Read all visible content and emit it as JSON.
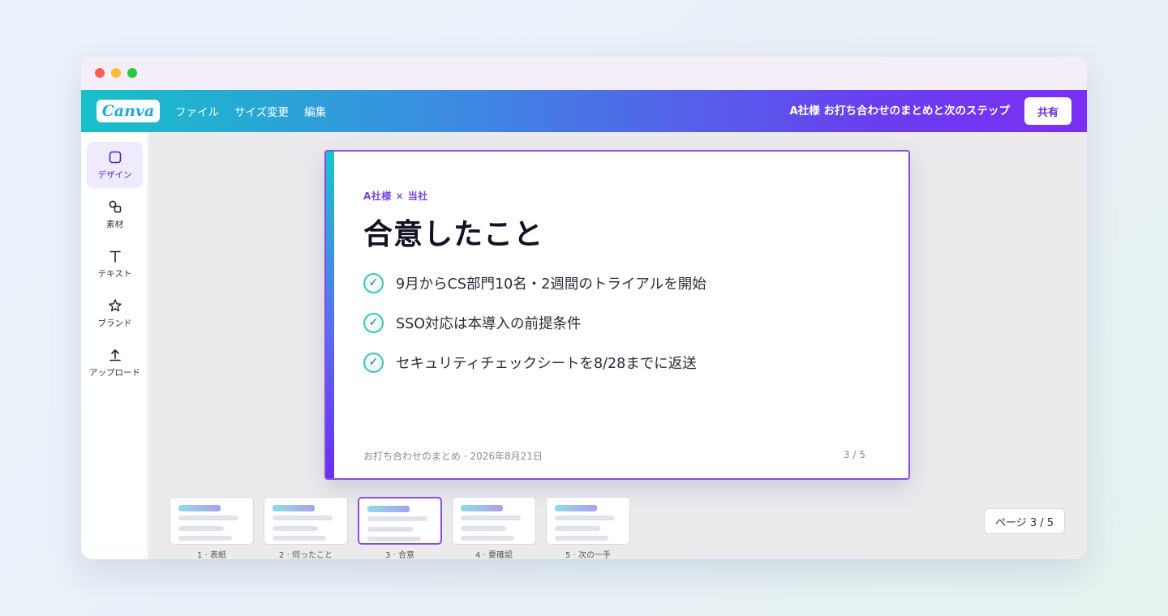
{
  "window": {
    "traffic_lights": [
      "close",
      "minimize",
      "zoom"
    ]
  },
  "topbar": {
    "logo": "Canva",
    "menu": [
      "ファイル",
      "サイズ変更",
      "編集"
    ],
    "doc_title": "A社様 お打ち合わせのまとめと次のステップ",
    "share_label": "共有"
  },
  "sidebar": {
    "items": [
      {
        "label": "デザイン",
        "icon": "square-icon",
        "active": true
      },
      {
        "label": "素材",
        "icon": "shapes-icon",
        "active": false
      },
      {
        "label": "テキスト",
        "icon": "text-icon",
        "active": false
      },
      {
        "label": "ブランド",
        "icon": "star-icon",
        "active": false
      },
      {
        "label": "アップロード",
        "icon": "upload-icon",
        "active": false
      }
    ]
  },
  "slide": {
    "kicker": "A社様 × 当社",
    "headline": "合意したこと",
    "points": [
      "9月からCS部門10名・2週間のトライアルを開始",
      "SSO対応は本導入の前提条件",
      "セキュリティチェックシートを8/28までに返送"
    ],
    "check_glyph": "✓",
    "footer": "お打ち合わせのまとめ · 2026年8月21日",
    "pager": "3 / 5"
  },
  "thumbnails": [
    {
      "label": "1 · 表紙",
      "active": false
    },
    {
      "label": "2 · 伺ったこと",
      "active": false
    },
    {
      "label": "3 · 合意",
      "active": true
    },
    {
      "label": "4 · 要確認",
      "active": false
    },
    {
      "label": "5 · 次の一手",
      "active": false
    }
  ],
  "page_badge": "ページ 3 / 5",
  "colors": {
    "brand_gradient_start": "#17c0c8",
    "brand_gradient_end": "#7b2ff4",
    "accent_purple": "#8c4ce0",
    "check_teal": "#3fc3b6"
  }
}
